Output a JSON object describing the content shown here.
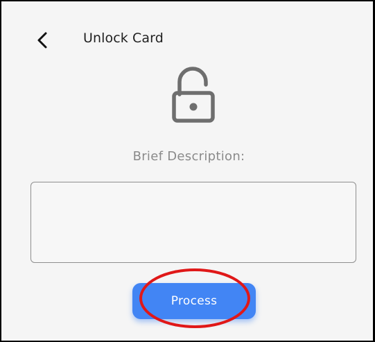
{
  "header": {
    "back_icon": "chevron-left-icon",
    "title": "Unlock Card"
  },
  "lock_icon": "unlocked-padlock-icon",
  "form": {
    "description_label": "Brief Description:",
    "description_value": "",
    "description_placeholder": "",
    "submit_label": "Process"
  },
  "colors": {
    "background": "#f5f5f5",
    "primary_button": "#4285f4",
    "icon_gray": "#6e6e6e",
    "highlight_ring": "#e01818"
  }
}
